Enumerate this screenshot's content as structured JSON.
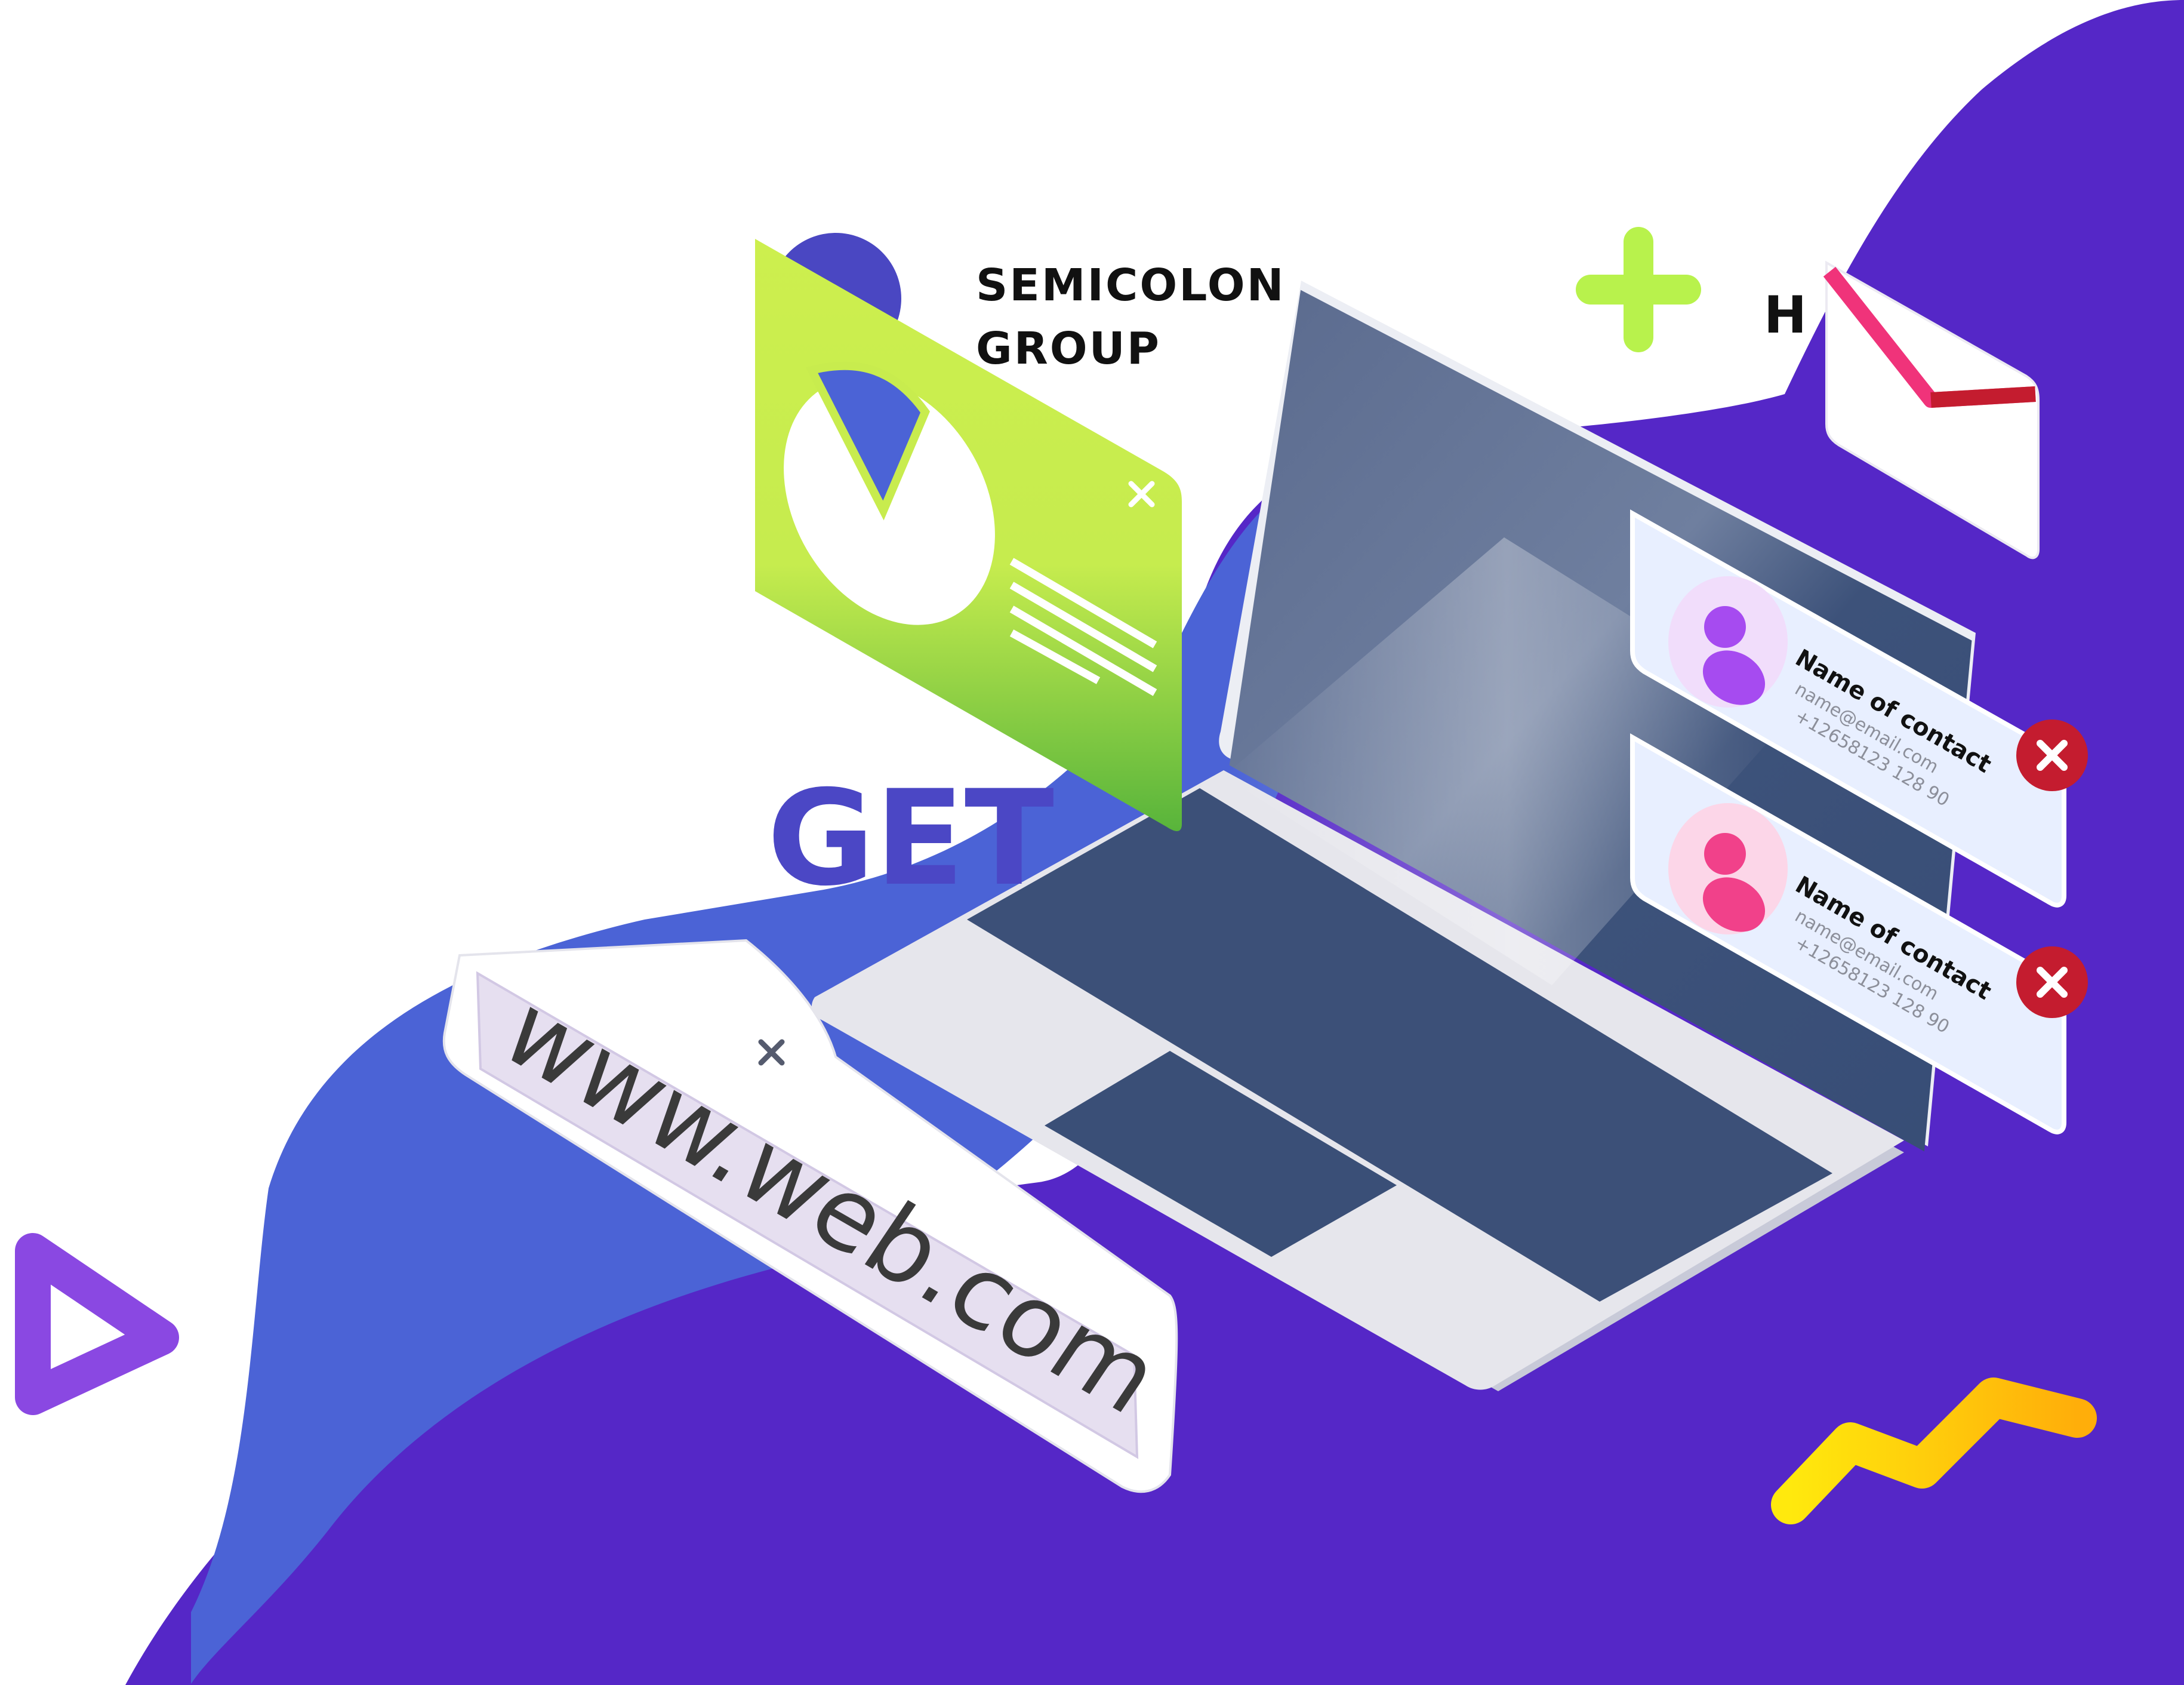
{
  "brand": {
    "line1": "SEMICOLON",
    "line2": "GROUP"
  },
  "headline_fragment": "GET",
  "partial_letter": "H",
  "url_bar": {
    "text": "www.web.com"
  },
  "contacts": [
    {
      "name": "Name of contact",
      "email": "name@email.com",
      "phone": "+12658123 128 90"
    },
    {
      "name": "Name of contact",
      "email": "name@email.com",
      "phone": "+12658123 128 90"
    }
  ],
  "colors": {
    "background": "#ffffff",
    "wave_purple": "#5527c7",
    "wave_blue": "#4c63d6",
    "lime_card": "#c9ef4f",
    "lime_card_bottom": "#56b63c",
    "laptop_screen": "#3c5078",
    "laptop_body": "#e6e6ec",
    "contact_card": "#e8efff",
    "remove_red": "#c41c2f",
    "envelope_pink": "#f0337a",
    "plus_green": "#b8f24c",
    "zigzag_yellow": "#ffd90a",
    "triangle_violet": "#8a48e2"
  },
  "icons": [
    "close-icon",
    "pie-chart-icon",
    "plus-icon",
    "envelope-icon",
    "user-avatar-icon",
    "remove-icon",
    "play-triangle-icon",
    "zigzag-icon"
  ]
}
